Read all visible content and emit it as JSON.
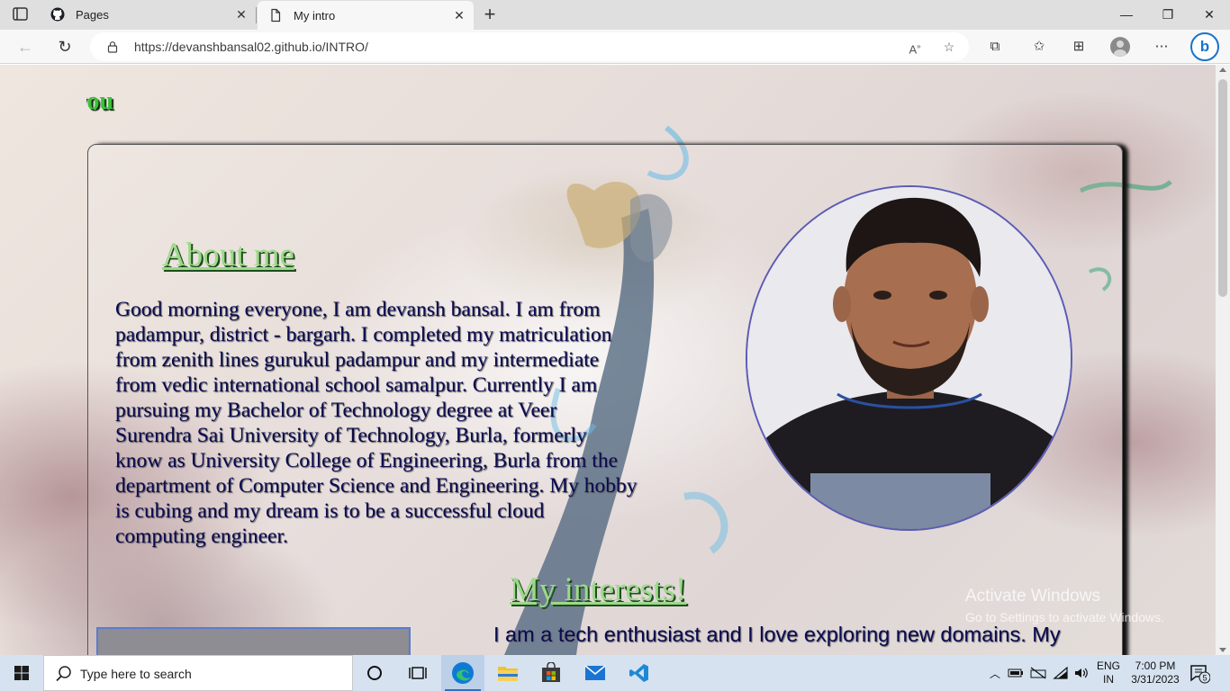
{
  "browser": {
    "tabs": [
      {
        "title": "Pages",
        "icon": "github-icon",
        "active": false
      },
      {
        "title": "My intro",
        "icon": "page-icon",
        "active": true
      }
    ],
    "url": "https://devanshbansal02.github.io/INTRO/",
    "bing_label": "b"
  },
  "page": {
    "marquee_text": "meet you",
    "about_title": "About me",
    "about_text": "Good morning everyone, I am devansh bansal. I am from padampur, district - bargarh. I completed my matriculation from zenith lines gurukul padampur and my intermediate from vedic international school samalpur. Currently I am pursuing my Bachelor of Technology degree at Veer Surendra Sai University of Technology, Burla, formerly know as University College of Engineering, Burla from the department of Computer Science and Engineering. My hobby is cubing and my dream is to be a successful cloud computing engineer.",
    "interests_title": "My interests!",
    "interests_text": "I am a tech enthusiast and I love exploring new domains. My",
    "colors": {
      "heading_green": "#9dd88a",
      "text_navy": "#0a0a50",
      "marquee_green": "#39c038"
    }
  },
  "watermark": {
    "line1": "Activate Windows",
    "line2": "Go to Settings to activate Windows."
  },
  "taskbar": {
    "search_placeholder": "Type here to search",
    "apps": [
      "cortana-icon",
      "task-view-icon",
      "edge-icon",
      "file-explorer-icon",
      "store-icon",
      "mail-icon",
      "vscode-icon"
    ],
    "lang_line1": "ENG",
    "lang_line2": "IN",
    "time": "7:00 PM",
    "date": "3/31/2023",
    "notification_count": "5"
  }
}
